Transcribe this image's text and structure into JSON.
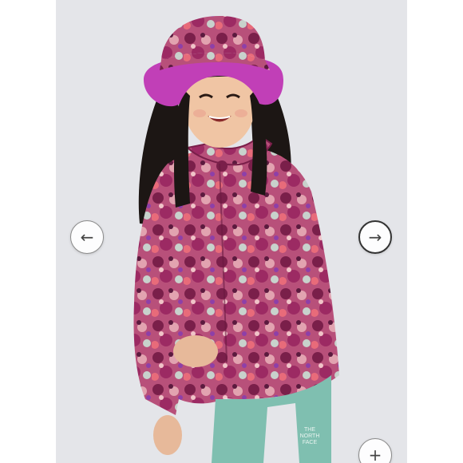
{
  "viewer": {
    "image_alt": "Child wearing a pink floral print bucket hat and rain jacket with teal leggings",
    "prev_glyph": "←",
    "next_glyph": "→",
    "zoom_glyph": "+"
  },
  "product": {
    "legging_logo_line1": "THE",
    "legging_logo_line2": "NORTH",
    "legging_logo_line3": "FACE"
  },
  "colors": {
    "background": "#e4e5e9",
    "jacket_base": "#b0406e",
    "hat_brim": "#c13fb7",
    "leggings": "#7fbfb0"
  }
}
